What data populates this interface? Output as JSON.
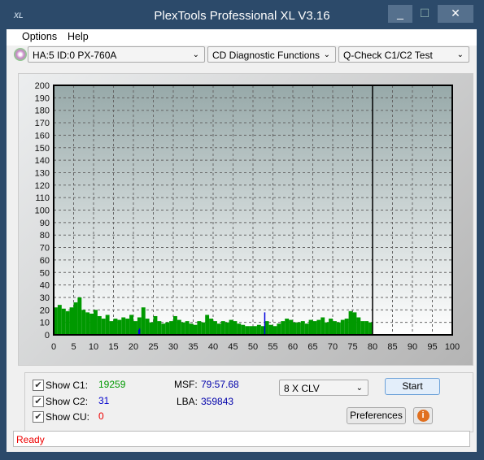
{
  "window": {
    "title": "PlexTools Professional XL V3.16",
    "logo": "XL",
    "minimize": "_",
    "maximize": "☐",
    "close": "✕"
  },
  "menu": [
    {
      "label": "Options"
    },
    {
      "label": "Help"
    }
  ],
  "toolbar": {
    "drive": "HA:5 ID:0  PX-760A",
    "function": "CD Diagnostic Functions",
    "test": "Q-Check C1/C2 Test",
    "drive_icon": "cd-icon"
  },
  "chart_data": {
    "type": "bar",
    "xlim": [
      0,
      100
    ],
    "ylim": [
      0,
      200
    ],
    "xticks": [
      0,
      5,
      10,
      15,
      20,
      25,
      30,
      35,
      40,
      45,
      50,
      55,
      60,
      65,
      70,
      75,
      80,
      85,
      90,
      95,
      100
    ],
    "yticks": [
      0,
      10,
      20,
      30,
      40,
      50,
      60,
      70,
      80,
      90,
      100,
      110,
      120,
      130,
      140,
      150,
      160,
      170,
      180,
      190,
      200
    ],
    "grid": true,
    "end_marker": 80,
    "series": [
      {
        "name": "C1",
        "color": "#009900",
        "x_step": 1,
        "values": [
          22,
          24,
          21,
          19,
          22,
          26,
          30,
          20,
          18,
          17,
          20,
          15,
          13,
          16,
          11,
          13,
          12,
          14,
          13,
          16,
          11,
          14,
          22,
          13,
          10,
          15,
          11,
          9,
          10,
          11,
          15,
          12,
          10,
          11,
          9,
          8,
          11,
          10,
          16,
          13,
          11,
          9,
          11,
          10,
          12,
          11,
          9,
          8,
          7,
          7,
          7,
          8,
          7,
          11,
          8,
          7,
          9,
          11,
          13,
          12,
          10,
          10,
          11,
          9,
          12,
          11,
          12,
          14,
          10,
          13,
          11,
          10,
          12,
          13,
          19,
          18,
          14,
          11,
          11,
          10
        ]
      },
      {
        "name": "C2",
        "color": "#0000dd",
        "points": [
          [
            21.2,
            4
          ],
          [
            21.4,
            5
          ],
          [
            52.8,
            18
          ]
        ]
      }
    ]
  },
  "controls": {
    "show_c1": "Show C1:",
    "c1_value": "19259",
    "show_c2": "Show C2:",
    "c2_value": "31",
    "show_cu": "Show CU:",
    "cu_value": "0",
    "msf_label": "MSF:",
    "msf_value": "79:57.68",
    "lba_label": "LBA:",
    "lba_value": "359843",
    "speed": "8 X CLV",
    "start": "Start",
    "preferences": "Preferences",
    "info_icon": "info-icon"
  },
  "status": "Ready"
}
